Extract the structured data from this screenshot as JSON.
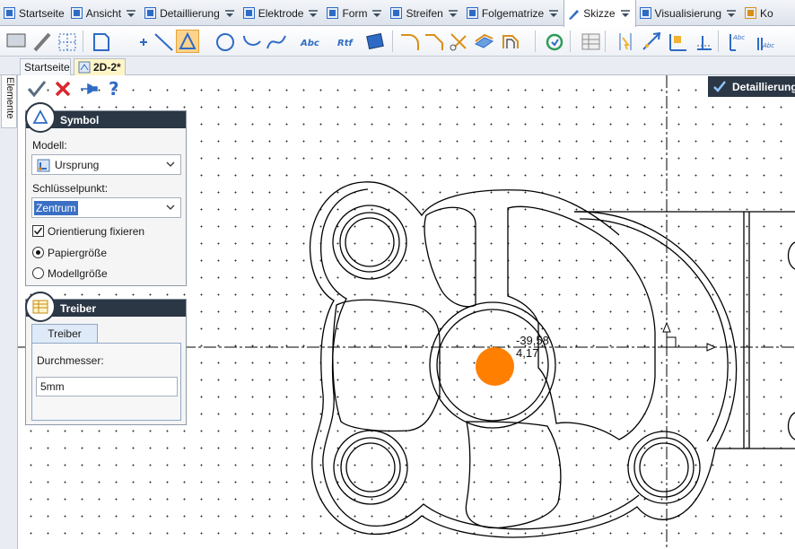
{
  "ribbon": {
    "tabs": [
      {
        "label": "Startseite",
        "icon": "gear-cube-icon",
        "chevron": false
      },
      {
        "label": "Ansicht",
        "icon": "view-icon",
        "chevron": true
      },
      {
        "label": "Detaillierung",
        "icon": "detailing-icon",
        "chevron": true
      },
      {
        "label": "Elektrode",
        "icon": "electrode-icon",
        "chevron": true
      },
      {
        "label": "Form",
        "icon": "form-icon",
        "chevron": true
      },
      {
        "label": "Streifen",
        "icon": "strip-icon",
        "chevron": true
      },
      {
        "label": "Folgematrize",
        "icon": "progressive-die-icon",
        "chevron": true
      },
      {
        "label": "Skizze",
        "icon": "sketch-pencil-icon",
        "chevron": true,
        "active": true
      },
      {
        "label": "Visualisierung",
        "icon": "visualization-icon",
        "chevron": true
      },
      {
        "label": "Ko",
        "icon": "construction-icon",
        "chevron": false
      }
    ]
  },
  "toolbar": {
    "tools": [
      "select-tool-icon",
      "pencil-icon",
      "grid-select-icon",
      "sketch-shape-icon",
      "point-icon",
      "line-icon",
      "symbol-triangle-icon",
      "circle-icon",
      "arc-icon",
      "spline-icon",
      "text-abc-icon",
      "rtf-text-icon",
      "picture-icon",
      "fillet-icon",
      "chamfer-icon",
      "trim-icon",
      "project-icon",
      "offset-icon",
      "regen-icon",
      "table-icon",
      "dimension-icon",
      "dimension-aligned-icon",
      "dimension-angle-icon",
      "dimension-ordinate-icon",
      "text-label-icon",
      "text-label-2-icon"
    ]
  },
  "documents": {
    "tabs": [
      {
        "label": "Startseite",
        "active": false
      },
      {
        "label": "2D-2*",
        "active": true
      }
    ]
  },
  "side_panel": {
    "label": "Elemente"
  },
  "actions": [
    {
      "name": "ok-check-icon",
      "color": "#5a6d80"
    },
    {
      "name": "cancel-x-icon",
      "color": "#d9272e"
    },
    {
      "name": "pin-icon",
      "color": "#2e6bc5"
    },
    {
      "name": "help-icon",
      "color": "#2e6bc5"
    }
  ],
  "symbol_panel": {
    "title": "Symbol",
    "model_label": "Modell:",
    "model_value": "Ursprung",
    "keypoint_label": "Schlüsselpunkt:",
    "keypoint_value": "Zentrum",
    "fix_orientation_label": "Orientierung fixieren",
    "fix_orientation_checked": true,
    "paper_size_label": "Papiergröße",
    "model_size_label": "Modellgröße",
    "size_mode": "paper"
  },
  "driver_panel": {
    "title": "Treiber",
    "tab_label": "Treiber",
    "diameter_label": "Durchmesser:",
    "diameter_value": "5mm"
  },
  "floating_bar": {
    "title": "Detaillierung"
  },
  "canvas": {
    "coord_x": "-39,58",
    "coord_y": "4,17",
    "marker_color": "#ff7f00",
    "grid_dot_color": "#303030"
  }
}
